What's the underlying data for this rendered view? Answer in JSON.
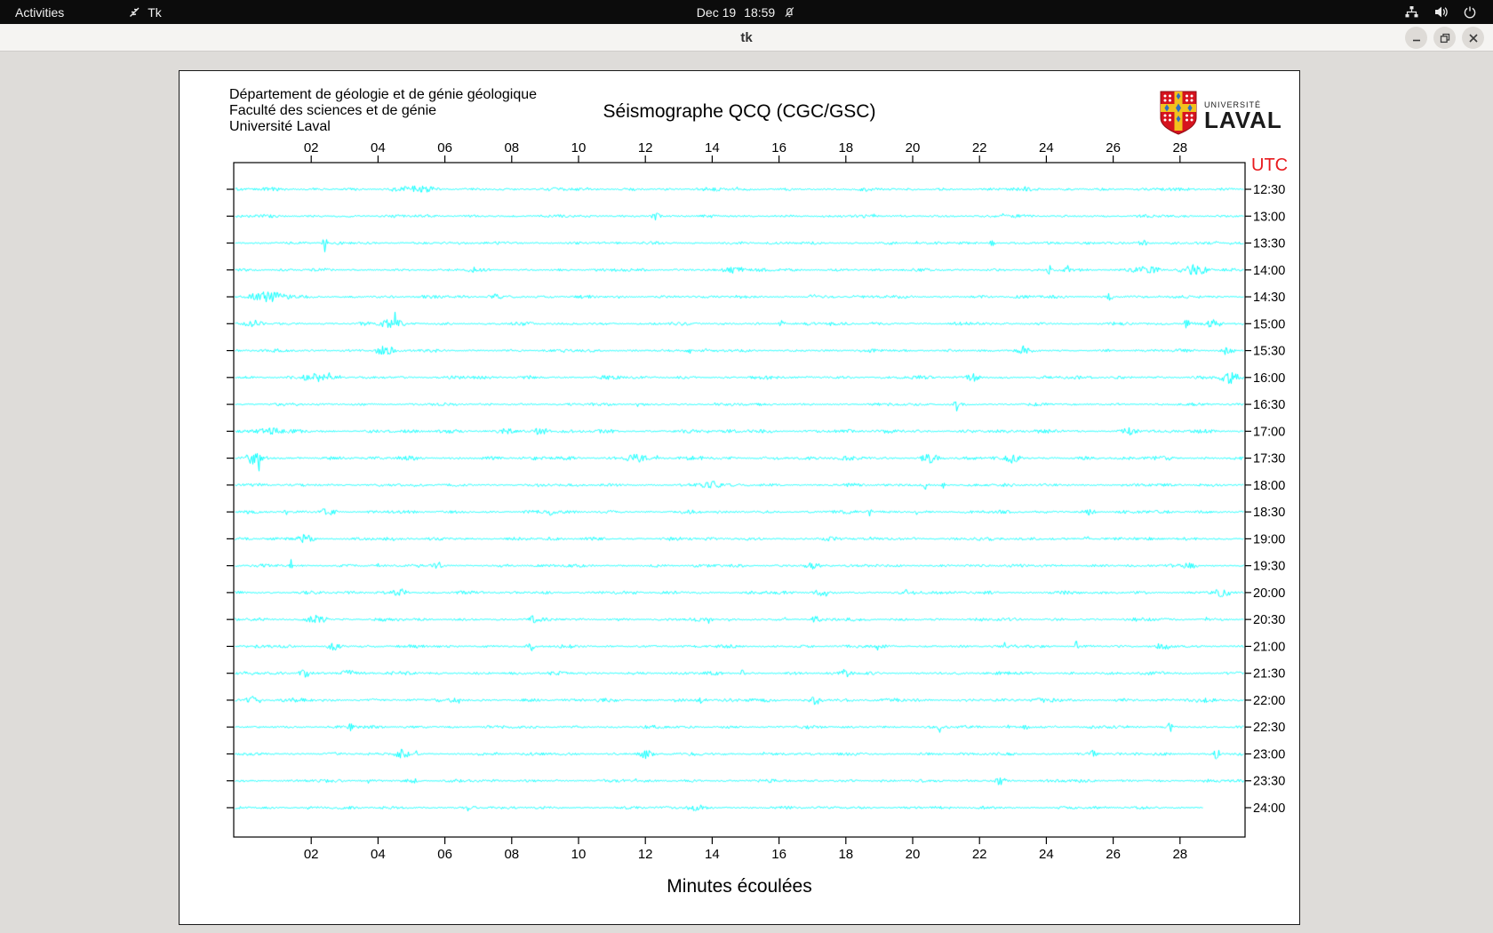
{
  "top_bar": {
    "activities_label": "Activities",
    "app_name": "Tk",
    "clock_date": "Dec 19",
    "clock_time": "18:59",
    "status_icons": [
      "notifications-off-icon",
      "network-wired-icon",
      "volume-icon",
      "power-icon"
    ]
  },
  "window": {
    "title": "tk",
    "controls": [
      "minimize",
      "restore",
      "close"
    ]
  },
  "page": {
    "institution_lines": [
      "Département de géologie et de génie géologique",
      "Faculté des sciences et de génie",
      "Université Laval"
    ],
    "logo": {
      "line1": "UNIVERSITÉ",
      "line2": "LAVAL"
    }
  },
  "chart_data": {
    "type": "line",
    "title": "Séismographe QCQ (CGC/GSC)",
    "xlabel": "Minutes écoulées",
    "right_axis_label": "UTC",
    "x_range": [
      0,
      30
    ],
    "x_ticks": [
      "02",
      "04",
      "06",
      "08",
      "10",
      "12",
      "14",
      "16",
      "18",
      "20",
      "22",
      "24",
      "26",
      "28"
    ],
    "x_tick_values": [
      2,
      4,
      6,
      8,
      10,
      12,
      14,
      16,
      18,
      20,
      22,
      24,
      26,
      28
    ],
    "grid": false,
    "trace_color": "#00ffff",
    "axis_color": "#000000",
    "utc_label_color": "#e8191d",
    "rows": [
      {
        "utc": "12:30",
        "base": 1.9,
        "end": 1.0,
        "events": [
          [
            5.0,
            3,
            0.8
          ]
        ]
      },
      {
        "utc": "13:00",
        "base": 1.7,
        "end": 1.0,
        "events": [
          [
            12.3,
            4,
            0.2
          ]
        ]
      },
      {
        "utc": "13:30",
        "base": 1.7,
        "end": 1.0,
        "events": [
          [
            2.4,
            10,
            0.1
          ],
          [
            22.4,
            4,
            0.15
          ],
          [
            26.9,
            4,
            0.3
          ]
        ]
      },
      {
        "utc": "14:00",
        "base": 1.7,
        "end": 1.0,
        "events": [
          [
            6.8,
            4,
            0.15
          ],
          [
            14.7,
            4,
            0.5
          ],
          [
            24.1,
            6,
            0.1
          ],
          [
            24.6,
            6,
            0.1
          ],
          [
            26.9,
            4,
            0.8
          ],
          [
            28.4,
            5,
            0.7
          ]
        ]
      },
      {
        "utc": "14:30",
        "base": 1.8,
        "end": 1.0,
        "events": [
          [
            0.7,
            5,
            0.9
          ],
          [
            7.5,
            3,
            0.3
          ],
          [
            17.0,
            4,
            0.15
          ],
          [
            25.9,
            6,
            0.12
          ]
        ]
      },
      {
        "utc": "15:00",
        "base": 1.8,
        "end": 1.0,
        "events": [
          [
            0.3,
            4,
            0.4
          ],
          [
            4.4,
            5,
            0.5
          ],
          [
            16.1,
            4,
            0.15
          ],
          [
            28.2,
            10,
            0.08
          ],
          [
            29.0,
            5,
            0.4
          ]
        ]
      },
      {
        "utc": "15:30",
        "base": 1.7,
        "end": 1.0,
        "events": [
          [
            4.2,
            5,
            0.5
          ],
          [
            13.3,
            4,
            0.15
          ],
          [
            23.3,
            4,
            0.2
          ],
          [
            29.4,
            5,
            0.3
          ]
        ]
      },
      {
        "utc": "16:00",
        "base": 2.0,
        "end": 1.0,
        "events": [
          [
            2.1,
            4,
            0.5
          ],
          [
            21.8,
            4,
            0.3
          ],
          [
            29.5,
            6,
            0.4
          ]
        ]
      },
      {
        "utc": "16:30",
        "base": 1.6,
        "end": 1.0,
        "events": [
          [
            21.3,
            9,
            0.08
          ]
        ]
      },
      {
        "utc": "17:00",
        "base": 2.2,
        "end": 1.0,
        "events": [
          [
            0.8,
            4,
            0.5
          ],
          [
            7.8,
            4,
            0.4
          ],
          [
            8.9,
            4,
            0.3
          ],
          [
            26.5,
            3,
            0.3
          ]
        ]
      },
      {
        "utc": "17:30",
        "base": 2.3,
        "end": 1.0,
        "events": [
          [
            0.3,
            5,
            0.4
          ],
          [
            11.7,
            5,
            0.4
          ],
          [
            20.5,
            5,
            0.35
          ],
          [
            23.0,
            4,
            0.3
          ]
        ]
      },
      {
        "utc": "18:00",
        "base": 1.8,
        "end": 1.0,
        "events": [
          [
            14.0,
            4,
            0.4
          ],
          [
            20.4,
            8,
            0.08
          ],
          [
            20.9,
            8,
            0.08
          ]
        ]
      },
      {
        "utc": "18:30",
        "base": 1.9,
        "end": 1.0,
        "events": [
          [
            2.5,
            4,
            0.4
          ],
          [
            9.2,
            4,
            0.2
          ],
          [
            18.7,
            5,
            0.12
          ],
          [
            25.3,
            3,
            0.3
          ]
        ]
      },
      {
        "utc": "19:00",
        "base": 2.0,
        "end": 1.0,
        "events": [
          [
            1.8,
            5,
            0.4
          ],
          [
            25.2,
            4,
            0.12
          ]
        ]
      },
      {
        "utc": "19:30",
        "base": 1.8,
        "end": 1.0,
        "events": [
          [
            1.4,
            8,
            0.08
          ],
          [
            5.8,
            4,
            0.2
          ],
          [
            17.0,
            4,
            0.3
          ],
          [
            28.3,
            4,
            0.3
          ]
        ]
      },
      {
        "utc": "20:00",
        "base": 2.0,
        "end": 1.0,
        "events": [
          [
            4.7,
            4,
            0.3
          ],
          [
            17.3,
            4,
            0.3
          ],
          [
            29.3,
            4,
            0.3
          ]
        ]
      },
      {
        "utc": "20:30",
        "base": 1.8,
        "end": 1.0,
        "events": [
          [
            2.2,
            5,
            0.4
          ],
          [
            8.6,
            4,
            0.15
          ],
          [
            13.9,
            4,
            0.15
          ],
          [
            17.1,
            4,
            0.2
          ]
        ]
      },
      {
        "utc": "21:00",
        "base": 1.8,
        "end": 1.0,
        "events": [
          [
            2.7,
            4,
            0.3
          ],
          [
            8.6,
            4,
            0.2
          ],
          [
            24.9,
            9,
            0.08
          ],
          [
            27.5,
            3,
            0.3
          ]
        ]
      },
      {
        "utc": "21:30",
        "base": 1.9,
        "end": 1.0,
        "events": [
          [
            1.8,
            5,
            0.3
          ],
          [
            3.1,
            4,
            0.3
          ],
          [
            14.9,
            4,
            0.15
          ],
          [
            18.0,
            4,
            0.2
          ]
        ]
      },
      {
        "utc": "22:00",
        "base": 2.2,
        "end": 1.0,
        "events": [
          [
            0.3,
            5,
            0.3
          ],
          [
            13.7,
            4,
            0.2
          ],
          [
            17.1,
            5,
            0.25
          ]
        ]
      },
      {
        "utc": "22:30",
        "base": 1.8,
        "end": 1.0,
        "events": [
          [
            3.2,
            4,
            0.12
          ],
          [
            20.8,
            6,
            0.1
          ],
          [
            23.4,
            4,
            0.12
          ],
          [
            27.7,
            10,
            0.08
          ]
        ]
      },
      {
        "utc": "23:00",
        "base": 1.8,
        "end": 1.0,
        "events": [
          [
            4.7,
            4,
            0.3
          ],
          [
            12.0,
            4,
            0.3
          ],
          [
            25.4,
            4,
            0.2
          ],
          [
            29.1,
            9,
            0.1
          ]
        ]
      },
      {
        "utc": "23:30",
        "base": 1.8,
        "end": 1.0,
        "events": [
          [
            5.0,
            3,
            0.3
          ],
          [
            22.6,
            4,
            0.25
          ]
        ]
      },
      {
        "utc": "24:00",
        "base": 1.7,
        "end": 0.957,
        "events": [
          [
            13.5,
            3,
            0.4
          ]
        ]
      }
    ]
  }
}
